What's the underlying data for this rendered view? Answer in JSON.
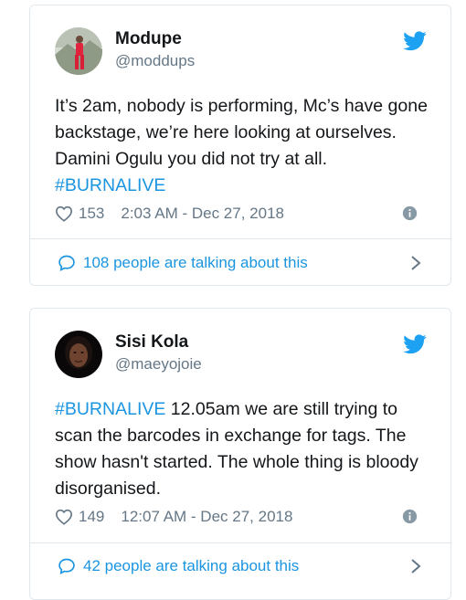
{
  "tweets": [
    {
      "name": "Modupe",
      "handle": "@moddups",
      "text_before": "It’s 2am, nobody is performing, Mc’s have gone backstage, we’re here looking at ourselves. Damini Ogulu you did not try at all. ",
      "hashtag": "#BURNALIVE",
      "text_after": "",
      "likes": "153",
      "timestamp": "2:03 AM - Dec 27, 2018",
      "talking": "108 people are talking about this"
    },
    {
      "name": "Sisi Kola",
      "handle": "@maeyojoie",
      "text_before": "",
      "hashtag": "#BURNALIVE",
      "text_after": " 12.05am we are still trying to scan the barcodes in exchange for tags. The show hasn't started. The whole thing is bloody disorganised.",
      "likes": "149",
      "timestamp": "12:07 AM - Dec 27, 2018",
      "talking": "42 people are talking about this"
    }
  ],
  "colors": {
    "link_blue": "#1b95e0",
    "twitter_blue": "#1da1f2",
    "secondary_text": "#657786",
    "border": "#e1e8ed"
  },
  "icons": [
    "twitter-bird-icon",
    "heart-icon",
    "info-icon",
    "speech-bubble-icon",
    "chevron-right-icon"
  ]
}
